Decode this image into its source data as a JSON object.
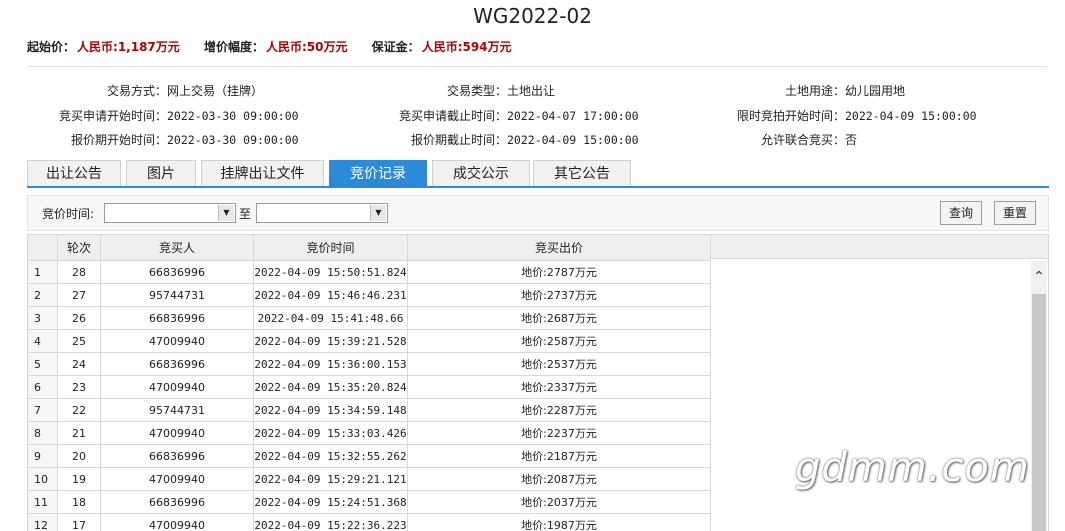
{
  "title": "WG2022-02",
  "price": {
    "start_label": "起始价：",
    "start_value": "人民币:1,187万元",
    "incr_label": "增价幅度：",
    "incr_value": "人民币:50万元",
    "deposit_label": "保证金：",
    "deposit_value": "人民币:594万元"
  },
  "info": [
    {
      "k": "交易方式：",
      "v": "网上交易（挂牌）"
    },
    {
      "k": "交易类型：",
      "v": "土地出让"
    },
    {
      "k": "土地用途：",
      "v": "幼儿园用地"
    },
    {
      "k": "竞买申请开始时间：",
      "v": "2022-03-30 09:00:00"
    },
    {
      "k": "竞买申请截止时间：",
      "v": "2022-04-07 17:00:00"
    },
    {
      "k": "限时竞拍开始时间：",
      "v": "2022-04-09 15:00:00"
    },
    {
      "k": "报价期开始时间：",
      "v": "2022-03-30 09:00:00"
    },
    {
      "k": "报价期截止时间：",
      "v": "2022-04-09 15:00:00"
    },
    {
      "k": "允许联合竞买：",
      "v": "否"
    }
  ],
  "tabs": [
    "出让公告",
    "图片",
    "挂牌出让文件",
    "竞价记录",
    "成交公示",
    "其它公告"
  ],
  "active_tab": 3,
  "filter": {
    "label": "竞价时间:",
    "to": "至",
    "query": "查询",
    "reset": "重置"
  },
  "table": {
    "headers": [
      "",
      "轮次",
      "竞买人",
      "竞价时间",
      "竞买出价"
    ],
    "rows": [
      [
        "1",
        "28",
        "66836996",
        "2022-04-09 15:50:51.824",
        "地价:2787万元"
      ],
      [
        "2",
        "27",
        "95744731",
        "2022-04-09 15:46:46.231",
        "地价:2737万元"
      ],
      [
        "3",
        "26",
        "66836996",
        "2022-04-09 15:41:48.66",
        "地价:2687万元"
      ],
      [
        "4",
        "25",
        "47009940",
        "2022-04-09 15:39:21.528",
        "地价:2587万元"
      ],
      [
        "5",
        "24",
        "66836996",
        "2022-04-09 15:36:00.153",
        "地价:2537万元"
      ],
      [
        "6",
        "23",
        "47009940",
        "2022-04-09 15:35:20.824",
        "地价:2337万元"
      ],
      [
        "7",
        "22",
        "95744731",
        "2022-04-09 15:34:59.148",
        "地价:2287万元"
      ],
      [
        "8",
        "21",
        "47009940",
        "2022-04-09 15:33:03.426",
        "地价:2237万元"
      ],
      [
        "9",
        "20",
        "66836996",
        "2022-04-09 15:32:55.262",
        "地价:2187万元"
      ],
      [
        "10",
        "19",
        "47009940",
        "2022-04-09 15:29:21.121",
        "地价:2087万元"
      ],
      [
        "11",
        "18",
        "66836996",
        "2022-04-09 15:24:51.368",
        "地价:2037万元"
      ],
      [
        "12",
        "17",
        "47009940",
        "2022-04-09 15:22:36.223",
        "地价:1987万元"
      ]
    ]
  },
  "watermark": "gdmm.com",
  "colors": {
    "accent": "#2c8ad8",
    "price_red": "#b00000"
  }
}
